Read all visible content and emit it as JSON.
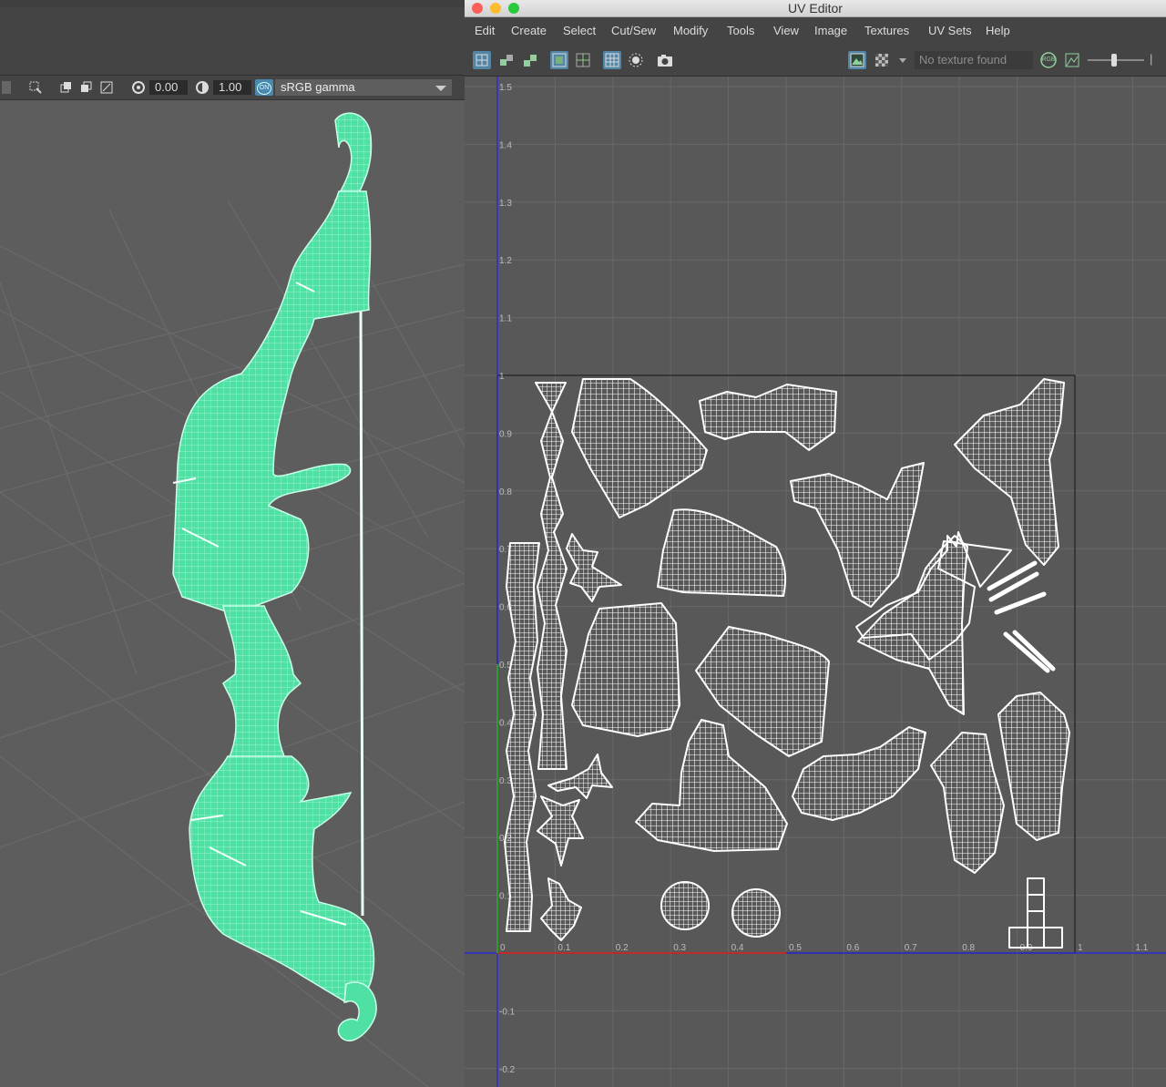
{
  "viewport_toolbar": {
    "exposure_value": "0.00",
    "gamma_value": "1.00",
    "color_management_badge": "ON",
    "color_space": "sRGB gamma"
  },
  "uv_editor": {
    "title": "UV Editor",
    "menu": [
      "Edit",
      "Create",
      "Select",
      "Cut/Sew",
      "Modify",
      "Tools",
      "View",
      "Image",
      "Textures",
      "UV Sets",
      "Help"
    ],
    "texture_status": "No texture found",
    "rgb_badge": "RGB",
    "axis_u_labels": [
      "0",
      "0.1",
      "0.2",
      "0.3",
      "0.4",
      "0.5",
      "0.6",
      "0.7",
      "0.8",
      "0.9",
      "1",
      "1.1"
    ],
    "axis_v_labels": [
      "1.5",
      "1.4",
      "1.3",
      "1.2",
      "1.1",
      "1",
      "0.9",
      "0.8",
      "0.7",
      "0.6",
      "0.5",
      "0.4",
      "0.3",
      "0.2",
      "0.1",
      "-0.1",
      "-0.2"
    ],
    "colors": {
      "grid_bg": "#585858",
      "grid_line": "#686868",
      "u_axis": "#c02a2a",
      "v_axis": "#2f9a2f",
      "border_blue": "#2a2ad6",
      "uv_shell": "#ffffff",
      "accent_button": "#5285a6"
    }
  },
  "viewport": {
    "mesh_color": "#4fe0a4",
    "wire_color": "#d6fff0",
    "grid_color": "#6c6c6c"
  }
}
